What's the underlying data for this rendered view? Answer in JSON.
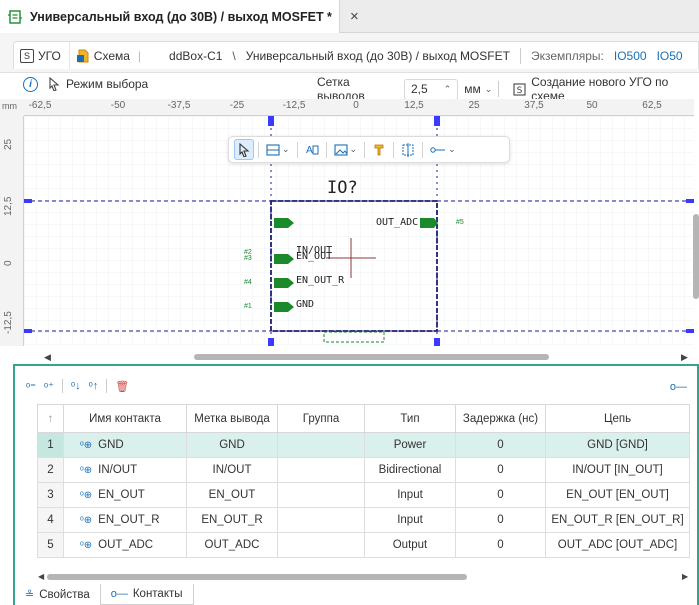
{
  "document_tab": {
    "title": "Универсальный вход (до 30В) / выход MOSFET *",
    "close": "×"
  },
  "view_tabs": [
    {
      "label": "УГО",
      "icon": "symbol-icon",
      "active": true
    },
    {
      "label": "Схема",
      "icon": "schematic-icon",
      "active": false
    }
  ],
  "breadcrumb": {
    "project": "ddBox-C1",
    "separator": "\\",
    "component": "Универсальный вход (до 30В) / выход MOSFET",
    "instances_label": "Экземпляры:",
    "instances": [
      "IO500",
      "IO50"
    ]
  },
  "toolbar": {
    "mode_label": "Режим выбора",
    "grid_label": "Сетка выводов",
    "grid_value": "2,5",
    "unit": "мм",
    "create_label": "Создание нового УГО по схеме"
  },
  "ruler": {
    "unit": "mm",
    "top_labels": [
      "-62,5",
      "-50",
      "-37,5",
      "-25",
      "-12,5",
      "0",
      "12,5",
      "25",
      "37,5",
      "50",
      "62,5"
    ],
    "left_labels": [
      "25",
      "12,5",
      "0",
      "-12,5"
    ]
  },
  "symbol": {
    "designator": "IO?",
    "pins": [
      {
        "num": "#2",
        "name": "IN/OUT",
        "side": "left"
      },
      {
        "num": "#3",
        "name": "EN_OUT",
        "side": "left"
      },
      {
        "num": "#4",
        "name": "EN_OUT_R",
        "side": "left"
      },
      {
        "num": "#1",
        "name": "GND",
        "side": "left"
      },
      {
        "num": "#5",
        "name": "OUT_ADC",
        "side": "right"
      }
    ],
    "pin_color": "#1a8a2a"
  },
  "panel": {
    "columns": [
      "",
      "Имя контакта",
      "Метка вывода",
      "Группа",
      "Тип",
      "Задержка (нс)",
      "Цепь"
    ],
    "sort_indicator": "↑",
    "rows": [
      {
        "num": "1",
        "name": "GND",
        "label": "GND",
        "group": "",
        "type": "Power",
        "delay": "0",
        "net": "GND [GND]",
        "selected": true
      },
      {
        "num": "2",
        "name": "IN/OUT",
        "label": "IN/OUT",
        "group": "",
        "type": "Bidirectional",
        "delay": "0",
        "net": "IN/OUT [IN_OUT]",
        "selected": false
      },
      {
        "num": "3",
        "name": "EN_OUT",
        "label": "EN_OUT",
        "group": "",
        "type": "Input",
        "delay": "0",
        "net": "EN_OUT [EN_OUT]",
        "selected": false
      },
      {
        "num": "4",
        "name": "EN_OUT_R",
        "label": "EN_OUT_R",
        "group": "",
        "type": "Input",
        "delay": "0",
        "net": "EN_OUT_R [EN_OUT_R]",
        "selected": false
      },
      {
        "num": "5",
        "name": "OUT_ADC",
        "label": "OUT_ADC",
        "group": "",
        "type": "Output",
        "delay": "0",
        "net": "OUT_ADC [OUT_ADC]",
        "selected": false
      }
    ],
    "bottom_tabs": [
      {
        "label": "Свойства",
        "icon": "properties-icon",
        "active": false
      },
      {
        "label": "Контакты",
        "icon": "pin-icon",
        "active": true
      }
    ]
  },
  "colors": {
    "accent": "#1a6fb5",
    "panel_border": "#34a58a",
    "selected_row": "#d9f0ec",
    "symbol_border": "#1e1e6e"
  }
}
